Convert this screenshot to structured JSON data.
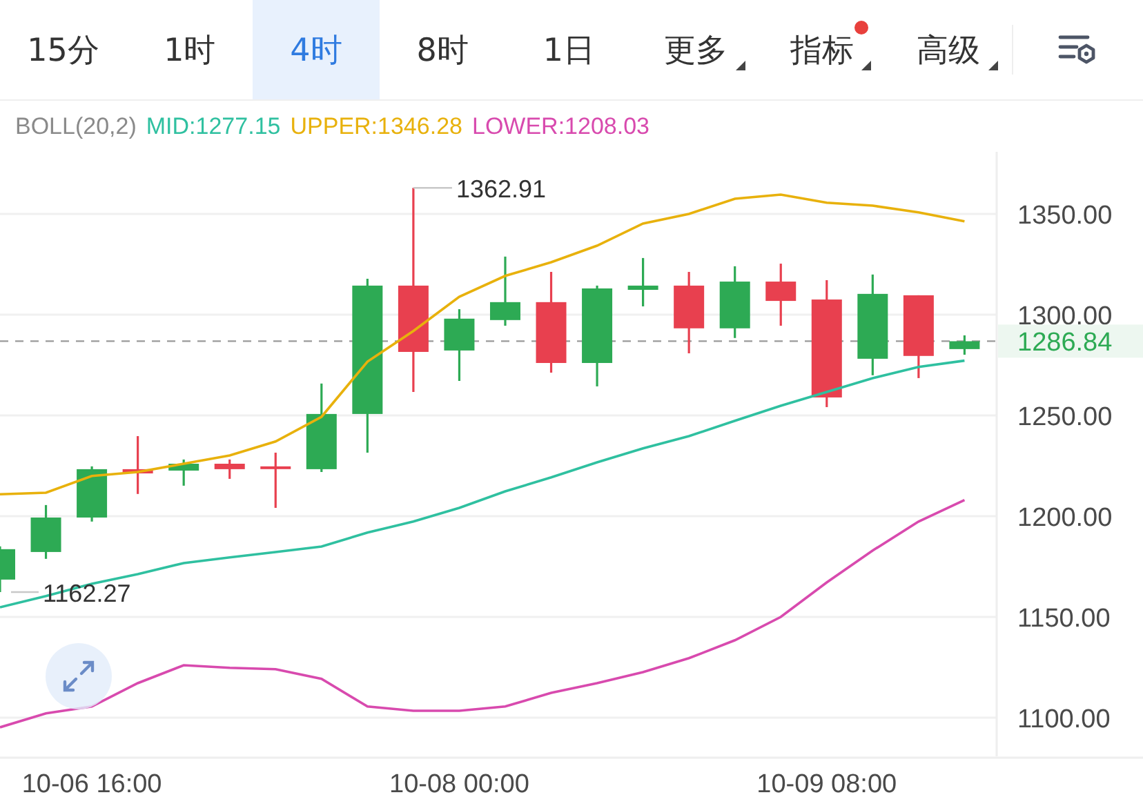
{
  "tabs": [
    {
      "label": "15分",
      "selected": false,
      "dropdown": false,
      "badge": false
    },
    {
      "label": "1时",
      "selected": false,
      "dropdown": false,
      "badge": false
    },
    {
      "label": "4时",
      "selected": true,
      "dropdown": false,
      "badge": false
    },
    {
      "label": "8时",
      "selected": false,
      "dropdown": false,
      "badge": false
    },
    {
      "label": "1日",
      "selected": false,
      "dropdown": false,
      "badge": false
    },
    {
      "label": "更多",
      "selected": false,
      "dropdown": true,
      "badge": false
    },
    {
      "label": "指标",
      "selected": false,
      "dropdown": true,
      "badge": true
    },
    {
      "label": "高级",
      "selected": false,
      "dropdown": true,
      "badge": false
    }
  ],
  "legend": [
    {
      "text": "BOLL(20,2)",
      "color": "#8a8a8a"
    },
    {
      "text": "MID:1277.15",
      "color": "#2fc0a0"
    },
    {
      "text": "UPPER:1346.28",
      "color": "#e8b10c"
    },
    {
      "text": "LOWER:1208.03",
      "color": "#d84aae"
    }
  ],
  "chart": {
    "chart_data": {
      "type": "line",
      "grid": true,
      "categories": [
        null,
        null,
        "10-06 16:00",
        null,
        null,
        null,
        null,
        null,
        null,
        null,
        "10-08 00:00",
        null,
        null,
        null,
        null,
        null,
        null,
        null,
        "10-09 08:00",
        null,
        null,
        null
      ],
      "ylim": [
        1080.8,
        1380.8
      ],
      "yticks": [
        {
          "value": 1350,
          "label": "1350.00"
        },
        {
          "value": 1300,
          "label": "1300.00"
        },
        {
          "value": 1250,
          "label": "1250.00"
        },
        {
          "value": 1200,
          "label": "1200.00"
        },
        {
          "value": 1150,
          "label": "1150.00"
        },
        {
          "value": 1100,
          "label": "1100.00"
        }
      ],
      "series": [
        {
          "color": "#e8b10c",
          "values": [
            1210.9,
            1211.6,
            1219.9,
            1221.9,
            1226,
            1230.1,
            1237,
            1249.3,
            1276.7,
            1291.8,
            1308.9,
            1319.2,
            1326,
            1334.2,
            1345.2,
            1350,
            1357.5,
            1359.6,
            1355.5,
            1354.1,
            1350.7,
            1346.3
          ]
        },
        {
          "color": "#2fc0a0",
          "values": [
            1154.8,
            1160.3,
            1166.4,
            1171.2,
            1176.7,
            1179.5,
            1182.2,
            1184.9,
            1191.8,
            1197.3,
            1204.1,
            1212.3,
            1219.2,
            1226.7,
            1233.6,
            1239.7,
            1247.3,
            1254.8,
            1261.6,
            1268.5,
            1274,
            1277.2
          ]
        },
        {
          "color": "#d84aae",
          "values": [
            1095.2,
            1102.1,
            1105.5,
            1117.1,
            1126,
            1124.7,
            1124,
            1119.2,
            1105.5,
            1103.4,
            1103.4,
            1105.5,
            1112.3,
            1117.1,
            1122.6,
            1129.5,
            1138.4,
            1150,
            1167.1,
            1182.9,
            1197.3,
            1208
          ]
        }
      ],
      "ref_lines": [
        {
          "axis": "y",
          "value": 1286.84,
          "label": "1286.84",
          "color": "#9a9a9a"
        }
      ],
      "annotations": [
        {
          "text": "1362.91"
        },
        {
          "text": "1162.27"
        }
      ]
    }
  }
}
